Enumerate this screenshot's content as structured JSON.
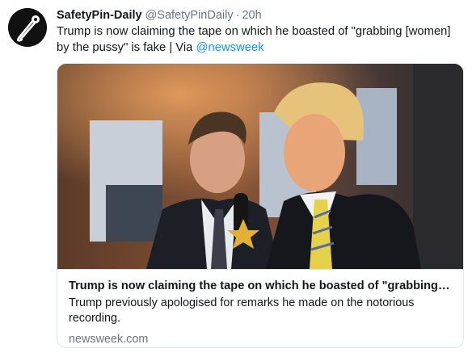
{
  "tweet": {
    "display_name": "SafetyPin-Daily",
    "handle": "@SafetyPinDaily",
    "separator": "·",
    "time": "20h",
    "text_before_link": "Trump is now claiming the tape on which he boasted of \"grabbing [women] by the pussy\" is fake | Via ",
    "link_text": "@newsweek",
    "avatar_icon": "safety-pin-icon"
  },
  "card": {
    "title": "Trump is now claiming the tape on which he boasted of \"grabbing [women] by the pussy\" is fake",
    "description": "Trump previously apologised for remarks he made on the notorious recording.",
    "domain": "newsweek.com"
  },
  "colors": {
    "link": "#1b95e0",
    "secondary_text": "#657786",
    "border": "#e1e8ed"
  }
}
